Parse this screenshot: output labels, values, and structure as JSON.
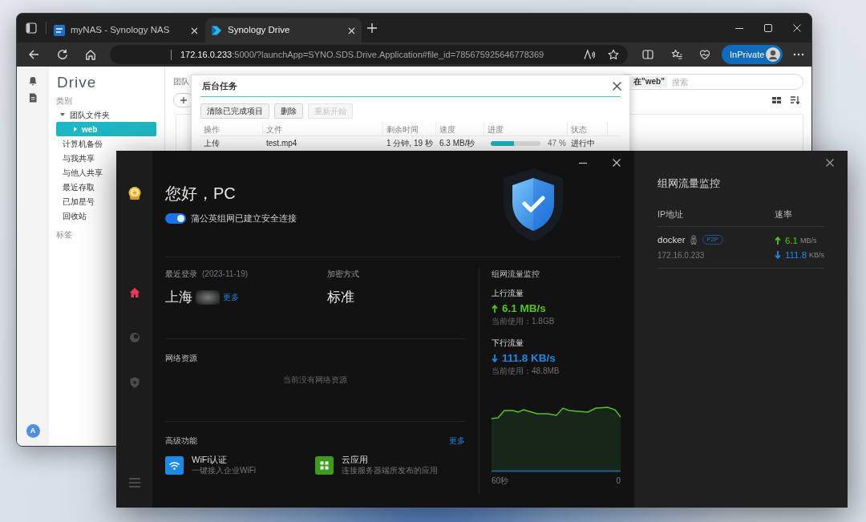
{
  "browser": {
    "tabs": [
      {
        "kind": "dsm",
        "label": "myNAS - Synology NAS",
        "selected": false
      },
      {
        "kind": "drive",
        "label": "Synology Drive",
        "selected": true
      }
    ],
    "address": {
      "host": "172.16.0.233",
      "path": ":5000/?launchApp=SYNO.SDS.Drive.Application#file_id=785675925646778369"
    },
    "profile_button": "InPrivate"
  },
  "drive": {
    "logo": "Drive",
    "category_header": "类别",
    "tree": [
      {
        "label": "团队文件夹",
        "expanded": true,
        "selected": false,
        "children": [
          {
            "label": "web",
            "expanded": false,
            "selected": true
          }
        ]
      },
      {
        "label": "计算机备份",
        "selected": false
      },
      {
        "label": "与我共享",
        "selected": false
      },
      {
        "label": "与他人共享",
        "selected": false
      },
      {
        "label": "最近存取",
        "selected": false
      },
      {
        "label": "已加星号",
        "selected": false
      },
      {
        "label": "回收站",
        "selected": false
      }
    ],
    "tags_header": "标签",
    "avatar": "A",
    "breadcrumb": "团队",
    "search": {
      "scope": "在\"web\"",
      "placeholder": "搜索"
    }
  },
  "task_dialog": {
    "title": "后台任务",
    "buttons": [
      {
        "label": "清除已完成项目",
        "disabled": false
      },
      {
        "label": "删除",
        "disabled": false
      },
      {
        "label": "重新开始",
        "disabled": true
      }
    ],
    "columns": [
      "操作",
      "文件",
      "剩余时间",
      "速度",
      "进度",
      "状态"
    ],
    "rows": [
      {
        "action": "上传",
        "file": "test.mp4",
        "remaining": "1 分钟, 19 秒",
        "speed": "6.3 MB/秒",
        "level": 0.47,
        "percent": "47 %",
        "status": "进行中"
      }
    ]
  },
  "vpn_client": {
    "nav": [
      {
        "kind": "home",
        "selected": true
      },
      {
        "kind": "orb",
        "selected": false
      },
      {
        "kind": "shield",
        "selected": false
      }
    ],
    "greeting": "您好，PC",
    "connection": {
      "on": true,
      "label": "蒲公英组网已建立安全连接"
    },
    "last_login": {
      "label": "最近登录",
      "date": "(2023-11-19)",
      "location": "上海",
      "more": "更多"
    },
    "encryption": {
      "label": "加密方式",
      "value": "标准"
    },
    "resources": {
      "title": "网络资源",
      "empty_text": "当前没有网络资源"
    },
    "advanced": {
      "title": "高级功能",
      "more": "更多",
      "features": [
        {
          "kind": "wifi",
          "title": "WiFi认证",
          "subtitle": "一键接入企业WiFi"
        },
        {
          "kind": "apps",
          "title": "云应用",
          "subtitle": "连接服务器端所发布的应用"
        }
      ]
    },
    "traffic": {
      "title": "组网流量监控",
      "upload": {
        "label": "上行流量",
        "rate": "6.1 MB/s",
        "usage": "当前使用：1.8GB"
      },
      "download": {
        "label": "下行流量",
        "rate": "111.8 KB/s",
        "usage": "当前使用：48.8MB"
      },
      "axis_start": "60秒",
      "axis_end": "0"
    }
  },
  "monitor_panel": {
    "title": "组网流量监控",
    "columns": [
      "IP地址",
      "速率"
    ],
    "peers": [
      {
        "name": "docker",
        "tag": "P2P",
        "ip": "172.16.0.233",
        "up_value": "6.1",
        "up_unit": "MB/s",
        "down_value": "111.8",
        "down_unit": "KB/s"
      }
    ]
  }
}
